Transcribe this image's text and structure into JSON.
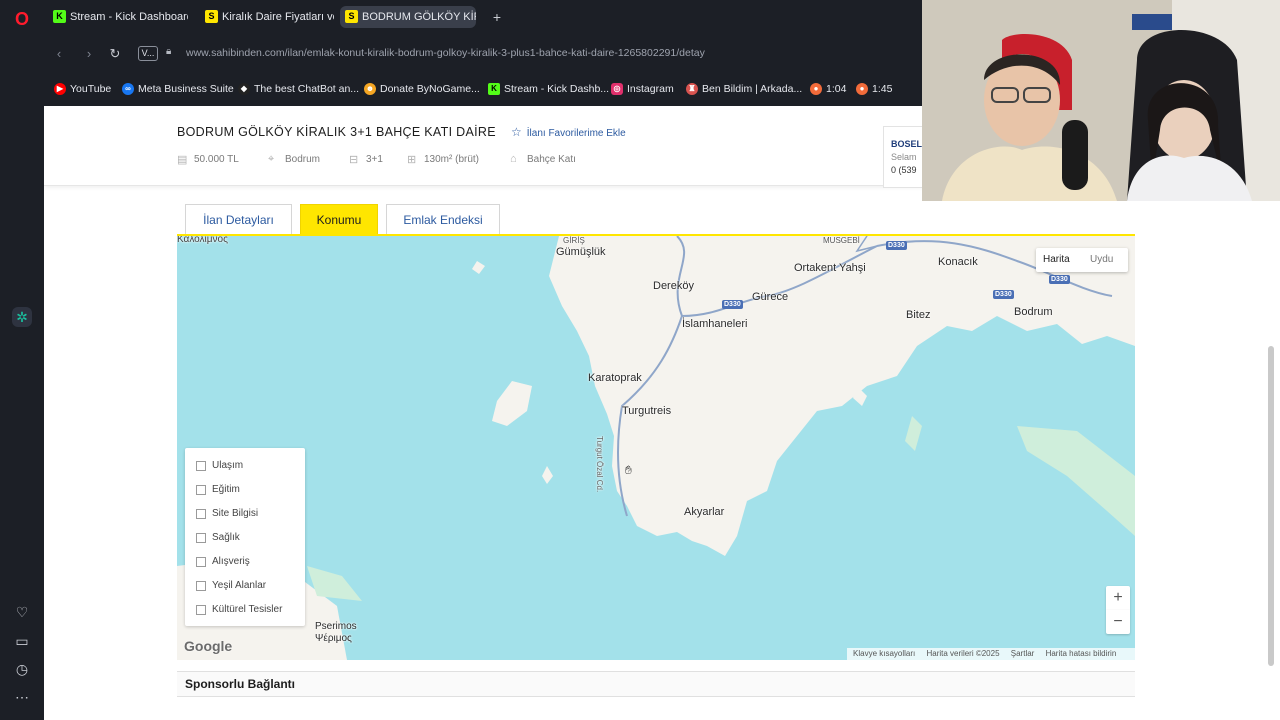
{
  "browser": {
    "tabs": [
      {
        "label": "Stream - Kick Dashboard",
        "fav": "K",
        "fav_color": "#53fc18"
      },
      {
        "label": "Kiralık Daire Fiyatları ve Ki",
        "fav": "S",
        "fav_color": "#ffe600"
      },
      {
        "label": "BODRUM GÖLKÖY KİRALI",
        "fav": "S",
        "fav_color": "#ffe600"
      }
    ],
    "new_tab": "+",
    "v_badge": "V...",
    "url": "www.sahibinden.com/ilan/emlak-konut-kiralik-bodrum-golkoy-kiralik-3-plus1-bahce-kati-daire-1265802291/detay",
    "bookmarks": [
      {
        "label": "YouTube",
        "fav_color": "#ff0000"
      },
      {
        "label": "Meta Business Suite",
        "fav_color": "#1877f2"
      },
      {
        "label": "The best ChatBot an...",
        "fav_color": "#222222"
      },
      {
        "label": "Donate ByNoGame...",
        "fav_color": "#f5a623"
      },
      {
        "label": "Stream - Kick Dashb...",
        "fav_color": "#53fc18"
      },
      {
        "label": "Instagram",
        "fav_color": "#e1306c"
      },
      {
        "label": "Ben Bildim | Arkada...",
        "fav_color": "#d9534f"
      },
      {
        "label": "1:04",
        "fav_color": "#f26b3a"
      },
      {
        "label": "1:45",
        "fav_color": "#f26b3a"
      }
    ]
  },
  "listing": {
    "title": "BODRUM GÖLKÖY KİRALIK 3+1 BAHÇE KATI DAİRE",
    "favorite_label": "İlanı Favorilerime Ekle",
    "meta": {
      "price": "50.000 TL",
      "location": "Bodrum",
      "rooms": "3+1",
      "area": "130m² (brüt)",
      "floor": "Bahçe Katı"
    },
    "seller": {
      "name": "BOSEL",
      "greeting": "Selam",
      "phone": "0 (539"
    }
  },
  "tabs": {
    "details": "İlan Detayları",
    "location": "Konumu",
    "index": "Emlak Endeksi"
  },
  "map": {
    "type_map": "Harita",
    "type_sat": "Uydu",
    "places": {
      "gumusluk": "Gümüşlük",
      "derekoy": "Dereköy",
      "ortakent": "Ortakent Yahşi",
      "gurece": "Gürece",
      "konacik": "Konacık",
      "bitez": "Bitez",
      "bodrum": "Bodrum",
      "islamhaneleri": "İslamhaneleri",
      "karatoprak": "Karatoprak",
      "turgutreis": "Turgutreis",
      "akyarlar": "Akyarlar",
      "pserimos": "Pserimos",
      "pserimos_gr": "Ψέριμος",
      "kalolimnos": "Καλόλιμνος",
      "giris": "GİRİŞ",
      "musgebi": "MUSGEBİ",
      "ozal": "Turgut Özal Cd."
    },
    "roads": [
      "D330",
      "D330",
      "D330",
      "D330"
    ],
    "layers": [
      "Ulaşım",
      "Eğitim",
      "Site Bilgisi",
      "Sağlık",
      "Alışveriş",
      "Yeşil Alanlar",
      "Kültürel Tesisler"
    ],
    "zoom_in": "+",
    "zoom_out": "−",
    "google": "Google",
    "attribution": [
      "Klavye kısayolları",
      "Harita verileri ©2025",
      "Şartlar",
      "Harita hatası bildirin"
    ]
  },
  "sponsored": "Sponsorlu Bağlantı",
  "colors": {
    "accent": "#ffe600",
    "link": "#2c5aa0",
    "sea": "#a3e1ea",
    "land": "#f5f3ee"
  }
}
